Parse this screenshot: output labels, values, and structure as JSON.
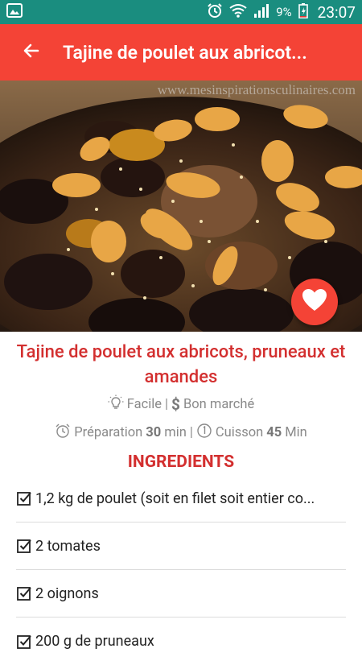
{
  "status_bar": {
    "battery": "9%",
    "time": "23:07",
    "icons": [
      "image-icon",
      "alarm-icon",
      "wifi-icon",
      "signal-icon",
      "battery-icon"
    ]
  },
  "app_bar": {
    "title": "Tajine de poulet aux abricot...",
    "back_icon": "arrow-left-icon"
  },
  "hero": {
    "watermark": "www.mesinspirationsculinaires.com"
  },
  "recipe": {
    "title": "Tajine de poulet aux abricots, pruneaux et amandes",
    "difficulty": "Facile",
    "separator": "|",
    "cost": "Bon marché",
    "prep_label": "Préparation",
    "prep_value": "30",
    "prep_unit": "min",
    "cook_label": "Cuisson",
    "cook_value": "45",
    "cook_unit": "Min"
  },
  "ingredients": {
    "heading": "INGREDIENTS",
    "items": [
      "1,2 kg de poulet (soit en filet soit entier co...",
      "2 tomates",
      "2 oignons",
      "200 g de pruneaux"
    ]
  },
  "colors": {
    "status_bar": "#1a8d7f",
    "accent": "#f44336",
    "title_red": "#d32f2f"
  }
}
